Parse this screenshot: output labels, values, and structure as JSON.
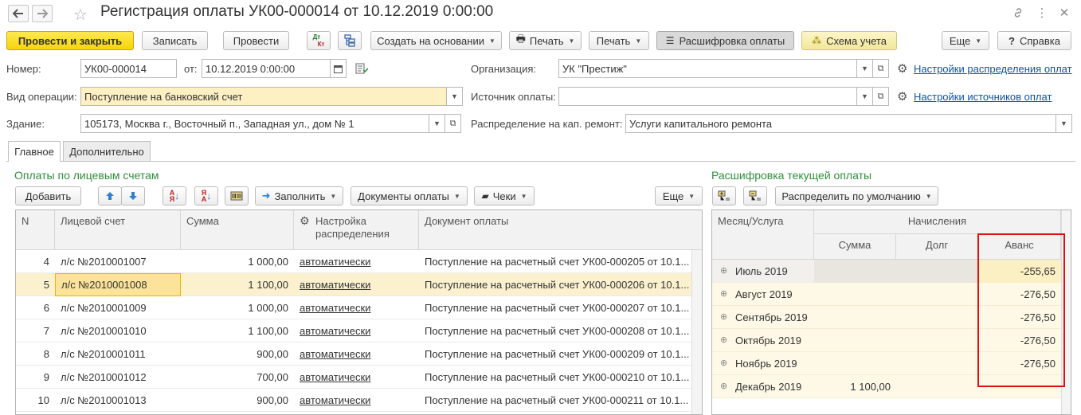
{
  "window": {
    "title": "Регистрация оплаты УК00-000014 от 10.12.2019 0:00:00"
  },
  "toolbar": {
    "post_close": "Провести и закрыть",
    "save": "Записать",
    "post": "Провести",
    "dtkt_top": "Дт",
    "dtkt_bottom": "Кт",
    "create_based": "Создать на основании",
    "print1": "Печать",
    "print2": "Печать",
    "payment_breakdown": "Расшифровка оплаты",
    "accounting_scheme": "Схема учета",
    "more": "Еще",
    "help": "Справка"
  },
  "form": {
    "number_label": "Номер:",
    "number_value": "УК00-000014",
    "from_label": "от:",
    "date_value": "10.12.2019  0:00:00",
    "org_label": "Организация:",
    "org_value": "УК \"Престиж\"",
    "distribution_settings_link": "Настройки распределения оплат",
    "operation_label": "Вид операции:",
    "operation_value": "Поступление на банковский счет",
    "source_label": "Источник оплаты:",
    "source_value": "",
    "source_settings_link": "Настройки источников оплат",
    "building_label": "Здание:",
    "building_value": "105173, Москва г., Восточный п., Западная ул., дом № 1",
    "cap_repair_label": "Распределение на кап. ремонт:",
    "cap_repair_value": "Услуги капитального ремонта"
  },
  "tabs": [
    {
      "label": "Главное"
    },
    {
      "label": "Дополнительно"
    }
  ],
  "payments": {
    "title": "Оплаты по лицевым счетам",
    "toolbar": {
      "add": "Добавить",
      "fill": "Заполнить",
      "docs": "Документы оплаты",
      "checks": "Чеки",
      "more": "Еще"
    },
    "columns": {
      "n": "N",
      "account": "Лицевой счет",
      "sum": "Сумма",
      "setting_line1": "Настройка",
      "setting_line2": "распределения",
      "doc": "Документ оплаты"
    },
    "rows": [
      {
        "n": "4",
        "account": "л/с №2010001007",
        "sum": "1 000,00",
        "setting": "автоматически",
        "doc": "Поступление на расчетный счет УК00-000205 от 10.1..."
      },
      {
        "n": "5",
        "account": "л/с №2010001008",
        "sum": "1 100,00",
        "setting": "автоматически",
        "doc": "Поступление на расчетный счет УК00-000206 от 10.1..."
      },
      {
        "n": "6",
        "account": "л/с №2010001009",
        "sum": "1 000,00",
        "setting": "автоматически",
        "doc": "Поступление на расчетный счет УК00-000207 от 10.1..."
      },
      {
        "n": "7",
        "account": "л/с №2010001010",
        "sum": "1 100,00",
        "setting": "автоматически",
        "doc": "Поступление на расчетный счет УК00-000208 от 10.1..."
      },
      {
        "n": "8",
        "account": "л/с №2010001011",
        "sum": "900,00",
        "setting": "автоматически",
        "doc": "Поступление на расчетный счет УК00-000209 от 10.1..."
      },
      {
        "n": "9",
        "account": "л/с №2010001012",
        "sum": "700,00",
        "setting": "автоматически",
        "doc": "Поступление на расчетный счет УК00-000210 от 10.1..."
      },
      {
        "n": "10",
        "account": "л/с №2010001013",
        "sum": "900,00",
        "setting": "автоматически",
        "doc": "Поступление на расчетный счет УК00-000211 от 10.1..."
      }
    ]
  },
  "breakdown": {
    "title": "Расшифровка текущей оплаты",
    "toolbar": {
      "distribute_default": "Распределить по умолчанию"
    },
    "columns": {
      "month": "Месяц/Услуга",
      "accruals": "Начисления",
      "sum": "Сумма",
      "debt": "Долг",
      "advance": "Аванс"
    },
    "rows": [
      {
        "month": "Июль 2019",
        "sum": "",
        "debt": "",
        "advance": "-255,65"
      },
      {
        "month": "Август 2019",
        "sum": "",
        "debt": "",
        "advance": "-276,50"
      },
      {
        "month": "Сентябрь 2019",
        "sum": "",
        "debt": "",
        "advance": "-276,50"
      },
      {
        "month": "Октябрь 2019",
        "sum": "",
        "debt": "",
        "advance": "-276,50"
      },
      {
        "month": "Ноябрь 2019",
        "sum": "",
        "debt": "",
        "advance": "-276,50"
      },
      {
        "month": "Декабрь 2019",
        "sum": "1 100,00",
        "debt": "",
        "advance": ""
      }
    ]
  },
  "colors": {
    "primary_button": "#f6d40c",
    "section_title": "#2f8e3e",
    "link": "#0a55a3",
    "highlight_box": "#e01010",
    "selected_row": "#fbf1cf"
  }
}
